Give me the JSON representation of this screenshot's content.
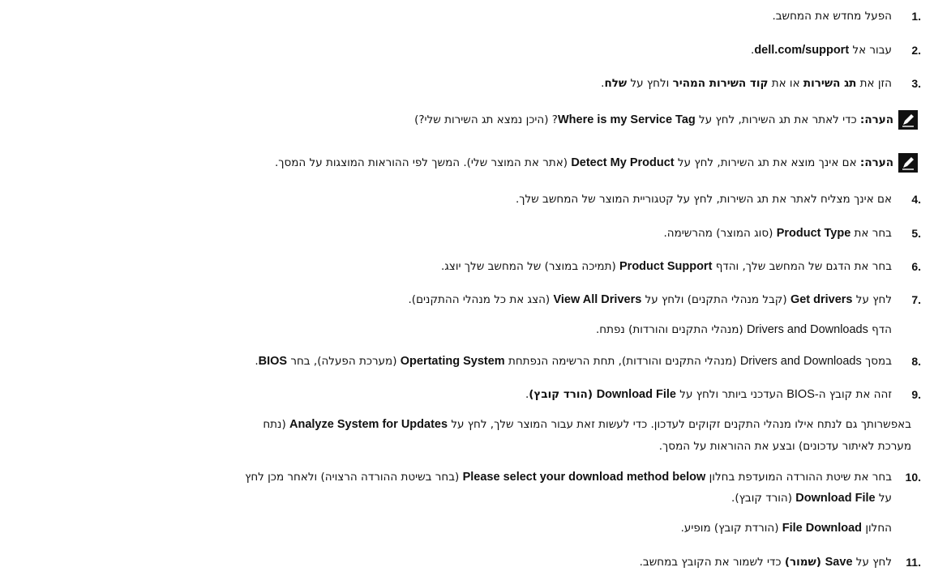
{
  "steps": [
    {
      "num": "1.",
      "text": "הפעל מחדש את המחשב."
    },
    {
      "num": "2.",
      "pre": "עבור אל ",
      "en": "dell.com/support",
      "post": "."
    },
    {
      "num": "3.",
      "p1": "הזן את ",
      "b1": "תג השירות",
      "p2": " או את ",
      "b2": "קוד השירות המהיר",
      "p3": " ולחץ על ",
      "b3": "שלח",
      "p4": "."
    },
    {
      "num": "4.",
      "text": "אם אינך מצליח לאתר את תג השירות, לחץ על קטגוריית המוצר של המחשב שלך."
    },
    {
      "num": "5.",
      "pre": "בחר את ",
      "en": "Product Type",
      "post": " (סוג המוצר) מהרשימה."
    },
    {
      "num": "6.",
      "pre": "בחר את הדגם של המחשב שלך, והדף ",
      "en": "Product Support",
      "post": " (תמיכה במוצר) של המחשב שלך יוצג."
    },
    {
      "num": "7.",
      "pre": "לחץ על ",
      "en1": "Get drivers",
      "mid": " (קבל מנהלי התקנים) ולחץ על ",
      "en2": "View All Drivers",
      "post": " (הצג את כל מנהלי ההתקנים).",
      "sub_pre": "הדף ",
      "sub_en": "Drivers and Downloads",
      "sub_post": " (מנהלי התקנים והורדות) נפתח."
    },
    {
      "num": "8.",
      "pre": "במסך ",
      "en1": "Drivers and Downloads",
      "mid": " (מנהלי התקנים והורדות), תחת הרשימה הנפתחת ",
      "en2": "Opertating System",
      "mid2": " (מערכת הפעלה), בחר ",
      "en3": "BIOS",
      "post": "."
    },
    {
      "num": "9.",
      "pre": "זהה את קובץ ה-",
      "en1": "BIOS",
      "mid": " העדכני ביותר ולחץ על ",
      "en2": "Download File",
      "b": " (הורד קובץ)",
      "post": ".",
      "par1_pre": "באפשרותך גם לנתח אילו מנהלי התקנים זקוקים לעדכון. כדי לעשות זאת עבור המוצר שלך, לחץ על ",
      "par1_en": "Analyze System for Updates",
      "par1_post": " (נתח",
      "par2": "מערכת לאיתור עדכונים) ובצע את ההוראות על המסך."
    },
    {
      "num": "10.",
      "pre": "בחר את שיטת ההורדה המועדפת בחלון ",
      "en": "Please select your download method below",
      "post": " (בחר בשיטת ההורדה הרצויה) ולאחר מכן לחץ",
      "l2_pre": "על ",
      "l2_en": "Download File",
      "l2_post": " (הורד קובץ).",
      "sub_pre": "החלון ",
      "sub_en": "File Download",
      "sub_post": " (הורדת קובץ) מופיע."
    },
    {
      "num": "11.",
      "pre": "לחץ על ",
      "en": "Save",
      "b": " (שמור)",
      "post": " כדי לשמור את הקובץ במחשב."
    }
  ],
  "notes": [
    {
      "label": "הערה:",
      "pre": " כדי לאתר את תג השירות, לחץ על ",
      "en": "Where is my Service Tag",
      "post": "? (היכן נמצא תג השירות שלי?)"
    },
    {
      "label": "הערה:",
      "pre": " אם אינך מוצא את תג השירות, לחץ על ",
      "en": "Detect My Product",
      "post": " (אתר את המוצר שלי). המשך לפי ההוראות המוצגות על המסך."
    }
  ]
}
